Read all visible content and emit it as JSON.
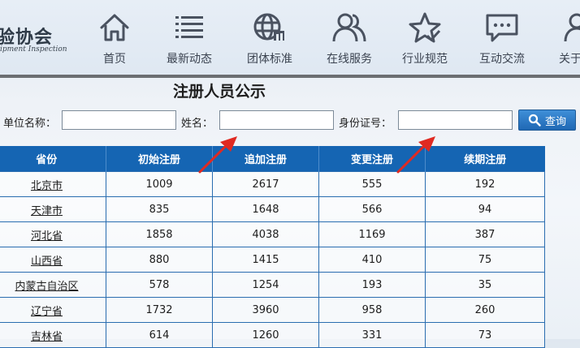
{
  "header": {
    "logo_text": "验协会",
    "logo_subtitle": "ipment Inspection",
    "nav": [
      {
        "label": "首页",
        "icon": "home-icon"
      },
      {
        "label": "最新动态",
        "icon": "list-icon"
      },
      {
        "label": "团体标准",
        "icon": "globe-icon"
      },
      {
        "label": "在线服务",
        "icon": "users-icon"
      },
      {
        "label": "行业规范",
        "icon": "star-check-icon"
      },
      {
        "label": "互动交流",
        "icon": "chat-icon"
      },
      {
        "label": "关于",
        "icon": "user-icon"
      }
    ]
  },
  "page_title": "注册人员公示",
  "search": {
    "unit_label": "单位名称：",
    "unit_value": "",
    "name_label": "姓名：",
    "name_value": "",
    "id_label": "身份证号：",
    "id_value": "",
    "query_label": "查询"
  },
  "table": {
    "headers": [
      "省份",
      "初始注册",
      "追加注册",
      "变更注册",
      "续期注册"
    ],
    "rows": [
      [
        "北京市",
        "1009",
        "2617",
        "555",
        "192"
      ],
      [
        "天津市",
        "835",
        "1648",
        "566",
        "94"
      ],
      [
        "河北省",
        "1858",
        "4038",
        "1169",
        "387"
      ],
      [
        "山西省",
        "880",
        "1415",
        "410",
        "75"
      ],
      [
        "内蒙古自治区",
        "578",
        "1254",
        "193",
        "35"
      ],
      [
        "辽宁省",
        "1732",
        "3960",
        "958",
        "260"
      ],
      [
        "吉林省",
        "614",
        "1260",
        "331",
        "73"
      ]
    ]
  },
  "colors": {
    "table_header": "#1565b3",
    "grid": "#2a6db0",
    "button": "#1f68b4",
    "arrow": "#e02a22"
  }
}
